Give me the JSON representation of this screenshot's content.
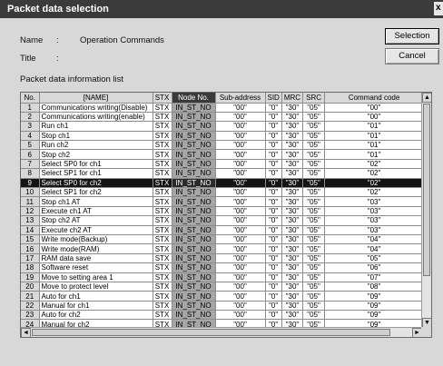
{
  "window": {
    "title": "Packet data selection",
    "close_glyph": "x"
  },
  "form": {
    "name_label": "Name",
    "name_sep": ":",
    "name_value": "Operation Commands",
    "title_label": "Title",
    "title_sep": ":",
    "list_label": "Packet data information list"
  },
  "buttons": {
    "selection": "Selection",
    "cancel": "Cancel"
  },
  "grid": {
    "columns": [
      "No.",
      "[NAME]",
      "STX",
      "Node No.",
      "Sub-address",
      "SID",
      "MRC",
      "SRC",
      "Command code"
    ],
    "selected_row": 9,
    "rows": [
      [
        "1",
        "Communications writing(Disable)",
        "STX",
        "IN_ST_NO",
        "\"00\"",
        "\"0\"",
        "\"30\"",
        "\"05\"",
        "\"00\""
      ],
      [
        "2",
        "Communications writing(enable)",
        "STX",
        "IN_ST_NO",
        "\"00\"",
        "\"0\"",
        "\"30\"",
        "\"05\"",
        "\"00\""
      ],
      [
        "3",
        "Run ch1",
        "STX",
        "IN_ST_NO",
        "\"00\"",
        "\"0\"",
        "\"30\"",
        "\"05\"",
        "\"01\""
      ],
      [
        "4",
        "Stop ch1",
        "STX",
        "IN_ST_NO",
        "\"00\"",
        "\"0\"",
        "\"30\"",
        "\"05\"",
        "\"01\""
      ],
      [
        "5",
        "Run ch2",
        "STX",
        "IN_ST_NO",
        "\"00\"",
        "\"0\"",
        "\"30\"",
        "\"05\"",
        "\"01\""
      ],
      [
        "6",
        "Stop ch2",
        "STX",
        "IN_ST_NO",
        "\"00\"",
        "\"0\"",
        "\"30\"",
        "\"05\"",
        "\"01\""
      ],
      [
        "7",
        "Select SP0 for ch1",
        "STX",
        "IN_ST_NO",
        "\"00\"",
        "\"0\"",
        "\"30\"",
        "\"05\"",
        "\"02\""
      ],
      [
        "8",
        "Select SP1 for ch1",
        "STX",
        "IN_ST_NO",
        "\"00\"",
        "\"0\"",
        "\"30\"",
        "\"05\"",
        "\"02\""
      ],
      [
        "9",
        "Select SP0 for ch2",
        "STX",
        "IN_ST_NO",
        "\"00\"",
        "\"0\"",
        "\"30\"",
        "\"05\"",
        "\"02\""
      ],
      [
        "10",
        "Select SP1 for ch2",
        "STX",
        "IN_ST_NO",
        "\"00\"",
        "\"0\"",
        "\"30\"",
        "\"05\"",
        "\"02\""
      ],
      [
        "11",
        "Stop ch1 AT",
        "STX",
        "IN_ST_NO",
        "\"00\"",
        "\"0\"",
        "\"30\"",
        "\"05\"",
        "\"03\""
      ],
      [
        "12",
        "Execute ch1 AT",
        "STX",
        "IN_ST_NO",
        "\"00\"",
        "\"0\"",
        "\"30\"",
        "\"05\"",
        "\"03\""
      ],
      [
        "13",
        "Stop ch2 AT",
        "STX",
        "IN_ST_NO",
        "\"00\"",
        "\"0\"",
        "\"30\"",
        "\"05\"",
        "\"03\""
      ],
      [
        "14",
        "Execute ch2 AT",
        "STX",
        "IN_ST_NO",
        "\"00\"",
        "\"0\"",
        "\"30\"",
        "\"05\"",
        "\"03\""
      ],
      [
        "15",
        "Write mode(Backup)",
        "STX",
        "IN_ST_NO",
        "\"00\"",
        "\"0\"",
        "\"30\"",
        "\"05\"",
        "\"04\""
      ],
      [
        "16",
        "Write mode(RAM)",
        "STX",
        "IN_ST_NO",
        "\"00\"",
        "\"0\"",
        "\"30\"",
        "\"05\"",
        "\"04\""
      ],
      [
        "17",
        "RAM data save",
        "STX",
        "IN_ST_NO",
        "\"00\"",
        "\"0\"",
        "\"30\"",
        "\"05\"",
        "\"05\""
      ],
      [
        "18",
        "Software reset",
        "STX",
        "IN_ST_NO",
        "\"00\"",
        "\"0\"",
        "\"30\"",
        "\"05\"",
        "\"06\""
      ],
      [
        "19",
        "Move to setting area 1",
        "STX",
        "IN_ST_NO",
        "\"00\"",
        "\"0\"",
        "\"30\"",
        "\"05\"",
        "\"07\""
      ],
      [
        "20",
        "Move to protect level",
        "STX",
        "IN_ST_NO",
        "\"00\"",
        "\"0\"",
        "\"30\"",
        "\"05\"",
        "\"08\""
      ],
      [
        "21",
        "Auto for ch1",
        "STX",
        "IN_ST_NO",
        "\"00\"",
        "\"0\"",
        "\"30\"",
        "\"05\"",
        "\"09\""
      ],
      [
        "22",
        "Manual for ch1",
        "STX",
        "IN_ST_NO",
        "\"00\"",
        "\"0\"",
        "\"30\"",
        "\"05\"",
        "\"09\""
      ],
      [
        "23",
        "Auto for ch2",
        "STX",
        "IN_ST_NO",
        "\"00\"",
        "\"0\"",
        "\"30\"",
        "\"05\"",
        "\"09\""
      ],
      [
        "24",
        "Manual for ch2",
        "STX",
        "IN_ST_NO",
        "\"00\"",
        "\"0\"",
        "\"30\"",
        "\"05\"",
        "\"09\""
      ]
    ]
  },
  "scrollbar": {
    "up": "▲",
    "down": "▼",
    "left": "◄",
    "right": "►"
  }
}
